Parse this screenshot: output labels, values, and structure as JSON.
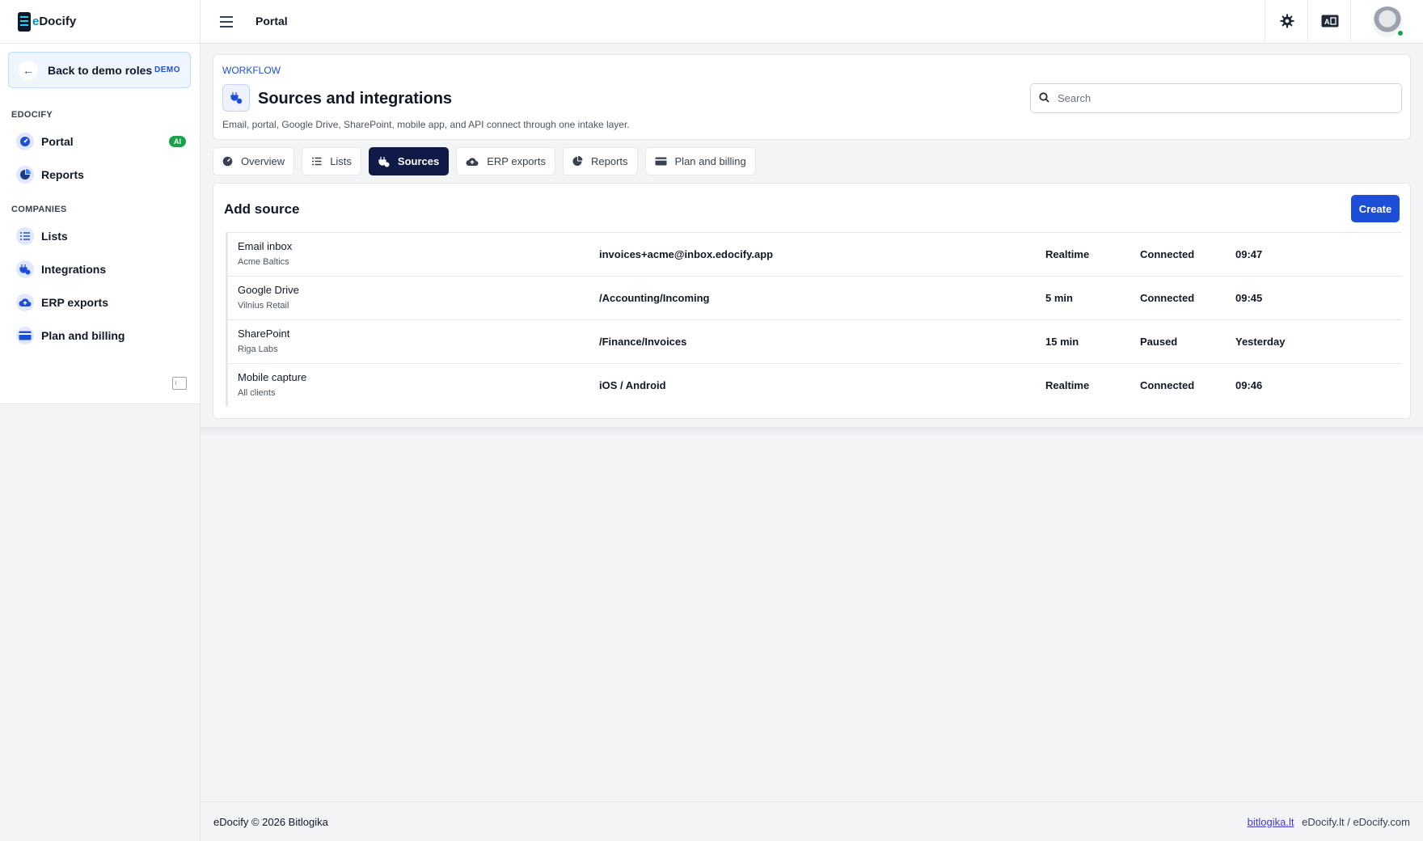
{
  "brand": {
    "prefix": "e",
    "name": "Docify"
  },
  "sidebar": {
    "back": {
      "label": "Back to demo roles",
      "badge": "DEMO"
    },
    "sections": [
      {
        "title": "EDOCIFY"
      },
      {
        "title": "COMPANIES"
      }
    ],
    "items": [
      {
        "label": "Portal",
        "icon": "dashboard-icon",
        "badge": "AI"
      },
      {
        "label": "Reports",
        "icon": "pie-chart-icon"
      },
      {
        "label": "Lists",
        "icon": "list-icon"
      },
      {
        "label": "Integrations",
        "icon": "plug-icon"
      },
      {
        "label": "ERP exports",
        "icon": "cloud-upload-icon"
      },
      {
        "label": "Plan and billing",
        "icon": "credit-card-icon"
      }
    ]
  },
  "header": {
    "title": "Portal",
    "icons": [
      "settings-gear-icon",
      "id-card-icon",
      "avatar"
    ]
  },
  "page": {
    "kicker": "WORKFLOW",
    "title": "Sources and integrations",
    "description": "Email, portal, Google Drive, SharePoint, mobile app, and API connect through one intake layer.",
    "search_placeholder": "Search"
  },
  "tabs": [
    {
      "label": "Overview",
      "icon": "dashboard-icon",
      "active": false
    },
    {
      "label": "Lists",
      "icon": "list-icon",
      "active": false
    },
    {
      "label": "Sources",
      "icon": "plug-icon",
      "active": true
    },
    {
      "label": "ERP exports",
      "icon": "cloud-upload-icon",
      "active": false
    },
    {
      "label": "Reports",
      "icon": "pie-chart-icon",
      "active": false
    },
    {
      "label": "Plan and billing",
      "icon": "credit-card-icon",
      "active": false
    }
  ],
  "sources": {
    "title": "Add source",
    "create_label": "Create",
    "rows": [
      {
        "name": "Email inbox",
        "client": "Acme Baltics",
        "target": "invoices+acme@inbox.edocify.app",
        "frequency": "Realtime",
        "status": "Connected",
        "time": "09:47"
      },
      {
        "name": "Google Drive",
        "client": "Vilnius Retail",
        "target": "/Accounting/Incoming",
        "frequency": "5 min",
        "status": "Connected",
        "time": "09:45"
      },
      {
        "name": "SharePoint",
        "client": "Riga Labs",
        "target": "/Finance/Invoices",
        "frequency": "15 min",
        "status": "Paused",
        "time": "Yesterday"
      },
      {
        "name": "Mobile capture",
        "client": "All clients",
        "target": "iOS / Android",
        "frequency": "Realtime",
        "status": "Connected",
        "time": "09:46"
      }
    ]
  },
  "footer": {
    "copyright": "eDocify © 2026 Bitlogika",
    "link": "bitlogika.lt",
    "domains": "eDocify.lt / eDocify.com"
  },
  "colors": {
    "primary": "#1d4ed8",
    "active_tab": "#0f1b46",
    "success": "#16a34a"
  }
}
